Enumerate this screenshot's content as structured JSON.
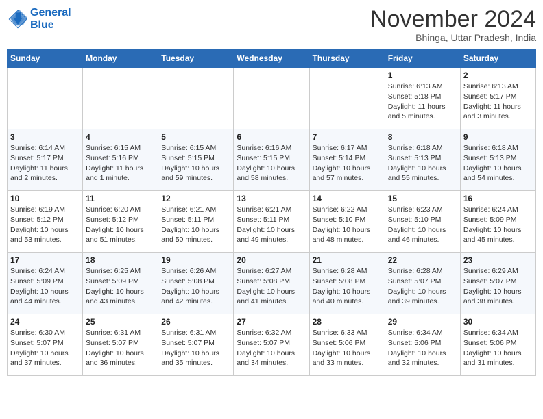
{
  "header": {
    "logo_line1": "General",
    "logo_line2": "Blue",
    "month": "November 2024",
    "location": "Bhinga, Uttar Pradesh, India"
  },
  "weekdays": [
    "Sunday",
    "Monday",
    "Tuesday",
    "Wednesday",
    "Thursday",
    "Friday",
    "Saturday"
  ],
  "weeks": [
    [
      {
        "day": "",
        "info": ""
      },
      {
        "day": "",
        "info": ""
      },
      {
        "day": "",
        "info": ""
      },
      {
        "day": "",
        "info": ""
      },
      {
        "day": "",
        "info": ""
      },
      {
        "day": "1",
        "info": "Sunrise: 6:13 AM\nSunset: 5:18 PM\nDaylight: 11 hours and 5 minutes."
      },
      {
        "day": "2",
        "info": "Sunrise: 6:13 AM\nSunset: 5:17 PM\nDaylight: 11 hours and 3 minutes."
      }
    ],
    [
      {
        "day": "3",
        "info": "Sunrise: 6:14 AM\nSunset: 5:17 PM\nDaylight: 11 hours and 2 minutes."
      },
      {
        "day": "4",
        "info": "Sunrise: 6:15 AM\nSunset: 5:16 PM\nDaylight: 11 hours and 1 minute."
      },
      {
        "day": "5",
        "info": "Sunrise: 6:15 AM\nSunset: 5:15 PM\nDaylight: 10 hours and 59 minutes."
      },
      {
        "day": "6",
        "info": "Sunrise: 6:16 AM\nSunset: 5:15 PM\nDaylight: 10 hours and 58 minutes."
      },
      {
        "day": "7",
        "info": "Sunrise: 6:17 AM\nSunset: 5:14 PM\nDaylight: 10 hours and 57 minutes."
      },
      {
        "day": "8",
        "info": "Sunrise: 6:18 AM\nSunset: 5:13 PM\nDaylight: 10 hours and 55 minutes."
      },
      {
        "day": "9",
        "info": "Sunrise: 6:18 AM\nSunset: 5:13 PM\nDaylight: 10 hours and 54 minutes."
      }
    ],
    [
      {
        "day": "10",
        "info": "Sunrise: 6:19 AM\nSunset: 5:12 PM\nDaylight: 10 hours and 53 minutes."
      },
      {
        "day": "11",
        "info": "Sunrise: 6:20 AM\nSunset: 5:12 PM\nDaylight: 10 hours and 51 minutes."
      },
      {
        "day": "12",
        "info": "Sunrise: 6:21 AM\nSunset: 5:11 PM\nDaylight: 10 hours and 50 minutes."
      },
      {
        "day": "13",
        "info": "Sunrise: 6:21 AM\nSunset: 5:11 PM\nDaylight: 10 hours and 49 minutes."
      },
      {
        "day": "14",
        "info": "Sunrise: 6:22 AM\nSunset: 5:10 PM\nDaylight: 10 hours and 48 minutes."
      },
      {
        "day": "15",
        "info": "Sunrise: 6:23 AM\nSunset: 5:10 PM\nDaylight: 10 hours and 46 minutes."
      },
      {
        "day": "16",
        "info": "Sunrise: 6:24 AM\nSunset: 5:09 PM\nDaylight: 10 hours and 45 minutes."
      }
    ],
    [
      {
        "day": "17",
        "info": "Sunrise: 6:24 AM\nSunset: 5:09 PM\nDaylight: 10 hours and 44 minutes."
      },
      {
        "day": "18",
        "info": "Sunrise: 6:25 AM\nSunset: 5:09 PM\nDaylight: 10 hours and 43 minutes."
      },
      {
        "day": "19",
        "info": "Sunrise: 6:26 AM\nSunset: 5:08 PM\nDaylight: 10 hours and 42 minutes."
      },
      {
        "day": "20",
        "info": "Sunrise: 6:27 AM\nSunset: 5:08 PM\nDaylight: 10 hours and 41 minutes."
      },
      {
        "day": "21",
        "info": "Sunrise: 6:28 AM\nSunset: 5:08 PM\nDaylight: 10 hours and 40 minutes."
      },
      {
        "day": "22",
        "info": "Sunrise: 6:28 AM\nSunset: 5:07 PM\nDaylight: 10 hours and 39 minutes."
      },
      {
        "day": "23",
        "info": "Sunrise: 6:29 AM\nSunset: 5:07 PM\nDaylight: 10 hours and 38 minutes."
      }
    ],
    [
      {
        "day": "24",
        "info": "Sunrise: 6:30 AM\nSunset: 5:07 PM\nDaylight: 10 hours and 37 minutes."
      },
      {
        "day": "25",
        "info": "Sunrise: 6:31 AM\nSunset: 5:07 PM\nDaylight: 10 hours and 36 minutes."
      },
      {
        "day": "26",
        "info": "Sunrise: 6:31 AM\nSunset: 5:07 PM\nDaylight: 10 hours and 35 minutes."
      },
      {
        "day": "27",
        "info": "Sunrise: 6:32 AM\nSunset: 5:07 PM\nDaylight: 10 hours and 34 minutes."
      },
      {
        "day": "28",
        "info": "Sunrise: 6:33 AM\nSunset: 5:06 PM\nDaylight: 10 hours and 33 minutes."
      },
      {
        "day": "29",
        "info": "Sunrise: 6:34 AM\nSunset: 5:06 PM\nDaylight: 10 hours and 32 minutes."
      },
      {
        "day": "30",
        "info": "Sunrise: 6:34 AM\nSunset: 5:06 PM\nDaylight: 10 hours and 31 minutes."
      }
    ]
  ]
}
